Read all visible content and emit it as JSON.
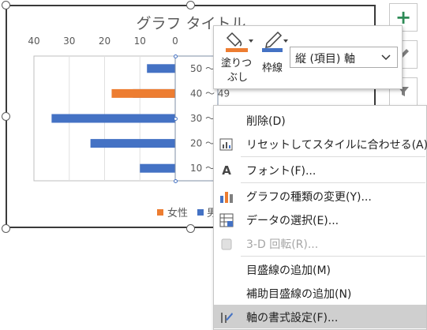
{
  "chart": {
    "title": "グラフ タイトル",
    "x_ticks": [
      "40",
      "30",
      "20",
      "10",
      "0"
    ],
    "y_categories": [
      "10 〜 19",
      "20 〜 29",
      "30 〜 39",
      "40 〜 49",
      "50 〜"
    ],
    "legend": {
      "female": "女性",
      "male": "男"
    }
  },
  "chart_data": {
    "type": "bar",
    "orientation": "horizontal",
    "title": "グラフ タイトル",
    "categories": [
      "10 〜 19",
      "20 〜 29",
      "30 〜 39",
      "40 〜 49",
      "50 〜"
    ],
    "series": [
      {
        "name": "男",
        "color": "#4472c4",
        "values": [
          10,
          24,
          35,
          12,
          8
        ]
      },
      {
        "name": "女性",
        "color": "#ed7d31",
        "values": [
          null,
          null,
          null,
          18,
          null
        ]
      }
    ],
    "xlim": [
      0,
      40
    ],
    "x_reversed": true,
    "grid": true,
    "legend_position": "bottom"
  },
  "side_buttons": {
    "elements": "+",
    "styles": "brush-icon",
    "filters": "filter-icon"
  },
  "mini_toolbar": {
    "fill_label_1": "塗りつ",
    "fill_label_2": "ぶし",
    "outline_label": "枠線",
    "selected_element": "縦 (項目) 軸",
    "fill_color": "#ed7d31",
    "outline_color": "#4472c4"
  },
  "context_menu": {
    "items": [
      {
        "label": "削除(D)",
        "icon": "delete-icon",
        "enabled": true
      },
      {
        "label": "リセットしてスタイルに合わせる(A)",
        "icon": "reset-style-icon",
        "enabled": true
      },
      {
        "label": "フォント(F)...",
        "icon": "font-icon",
        "enabled": true
      },
      {
        "label": "グラフの種類の変更(Y)...",
        "icon": "chart-type-icon",
        "enabled": true
      },
      {
        "label": "データの選択(E)...",
        "icon": "select-data-icon",
        "enabled": true
      },
      {
        "label": "3-D 回転(R)...",
        "icon": "3d-rotation-icon",
        "enabled": false
      },
      {
        "label": "目盛線の追加(M)",
        "icon": "",
        "enabled": true
      },
      {
        "label": "補助目盛線の追加(N)",
        "icon": "",
        "enabled": true
      },
      {
        "label": "軸の書式設定(F)...",
        "icon": "format-axis-icon",
        "enabled": true,
        "highlighted": true
      }
    ]
  }
}
